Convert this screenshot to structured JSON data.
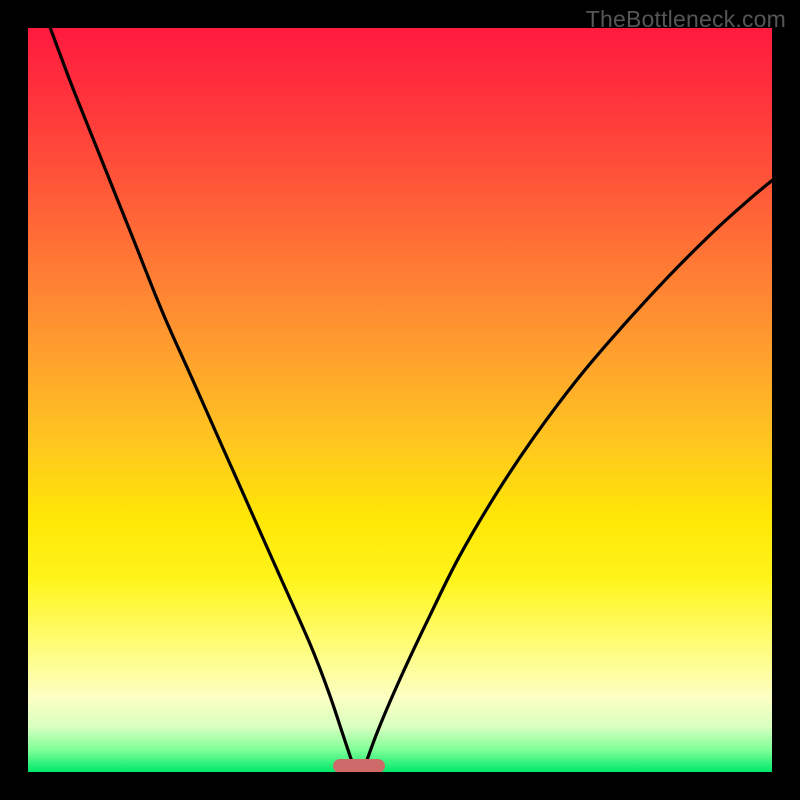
{
  "watermark": "TheBottleneck.com",
  "chart_data": {
    "type": "line",
    "title": "",
    "xlabel": "",
    "ylabel": "",
    "xlim": [
      0,
      100
    ],
    "ylim": [
      0,
      100
    ],
    "grid": false,
    "marker": {
      "x_center": 44.5,
      "width": 7,
      "y": 0
    },
    "series": [
      {
        "name": "left-curve",
        "x": [
          3.0,
          6.0,
          10.0,
          14.0,
          18.0,
          22.0,
          26.0,
          30.0,
          34.0,
          38.0,
          40.5,
          42.5,
          44.0
        ],
        "y": [
          100.0,
          92.0,
          82.0,
          72.0,
          62.0,
          53.0,
          44.0,
          35.0,
          26.0,
          17.0,
          10.5,
          4.5,
          0.0
        ]
      },
      {
        "name": "right-curve",
        "x": [
          45.0,
          47.0,
          50.0,
          54.0,
          58.0,
          63.0,
          68.0,
          74.0,
          80.0,
          86.0,
          92.0,
          97.0,
          100.0
        ],
        "y": [
          0.0,
          5.5,
          12.5,
          21.0,
          29.0,
          37.5,
          45.0,
          53.0,
          60.0,
          66.5,
          72.5,
          77.0,
          79.5
        ]
      }
    ],
    "background_gradient": {
      "top_color": "#ff1a3f",
      "mid_color": "#ffe705",
      "bottom_color": "#00e96a"
    }
  }
}
